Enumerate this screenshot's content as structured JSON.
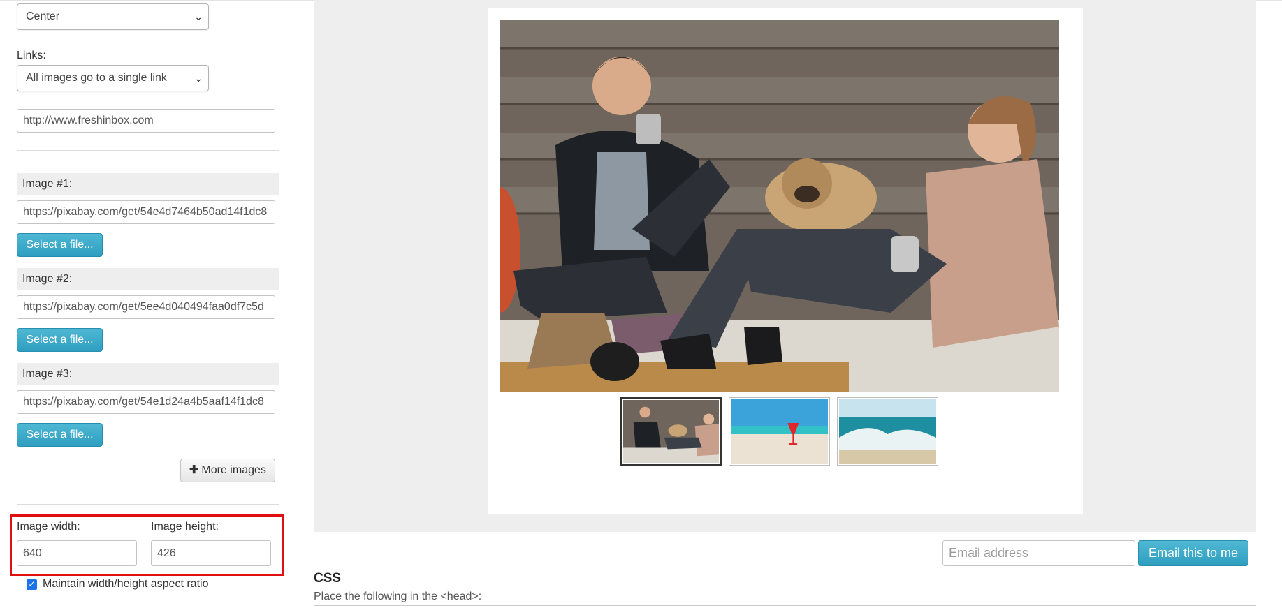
{
  "sidebar": {
    "alignment_select": {
      "value": "Center"
    },
    "links_label": "Links:",
    "links_select": {
      "value": "All images go to a single link"
    },
    "link_url": "http://www.freshinbox.com",
    "images": [
      {
        "label": "Image #1:",
        "url": "https://pixabay.com/get/54e4d7464b50ad14f1dc8",
        "button": "Select a file..."
      },
      {
        "label": "Image #2:",
        "url": "https://pixabay.com/get/5ee4d040494faa0df7c5d",
        "button": "Select a file..."
      },
      {
        "label": "Image #3:",
        "url": "https://pixabay.com/get/54e1d24a4b5aaf14f1dc8",
        "button": "Select a file..."
      }
    ],
    "more_images_label": "More images",
    "image_width_label": "Image width:",
    "image_width_value": "640",
    "image_height_label": "Image height:",
    "image_height_value": "426",
    "aspect_ratio_label": "Maintain width/height aspect ratio",
    "aspect_ratio_checked": true
  },
  "preview": {
    "thumbnails": [
      {
        "name": "couple-with-pug",
        "active": true
      },
      {
        "name": "beach-with-red-drink",
        "active": false
      },
      {
        "name": "ocean-wave",
        "active": false
      }
    ]
  },
  "email": {
    "placeholder": "Email address",
    "button_label": "Email this to me"
  },
  "css_section": {
    "heading": "CSS",
    "subtext": "Place the following in the <head>:"
  },
  "colors": {
    "accent": "#31a2c4",
    "highlight": "#e01010",
    "preview_bg": "#eeeeee"
  }
}
